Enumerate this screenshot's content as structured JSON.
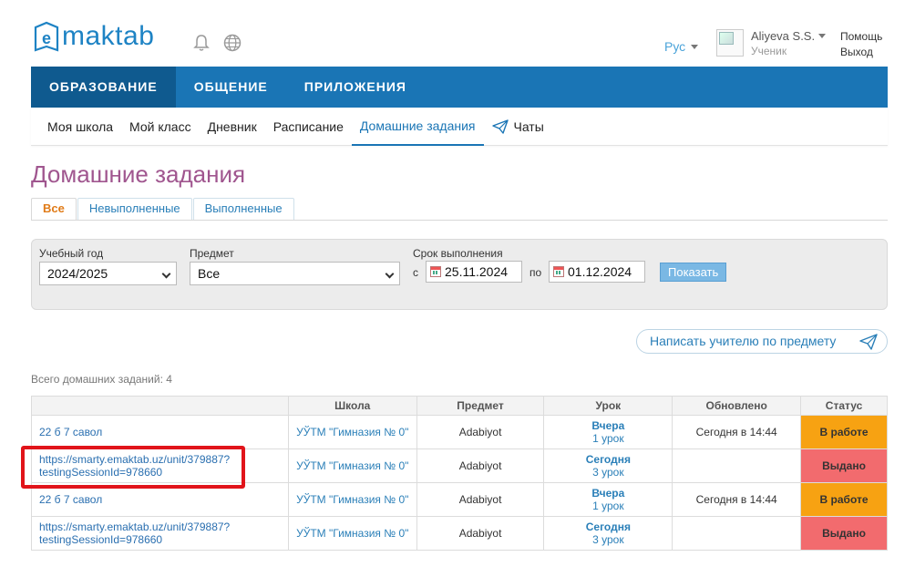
{
  "header": {
    "logo_text": "maktab",
    "logo_letter": "e",
    "language": "Рус",
    "user_name": "Aliyeva S.S.",
    "user_role": "Ученик",
    "help": "Помощь",
    "logout": "Выход"
  },
  "main_nav": [
    "ОБРАЗОВАНИЕ",
    "ОБЩЕНИЕ",
    "ПРИЛОЖЕНИЯ"
  ],
  "sub_nav": [
    "Моя школа",
    "Мой класс",
    "Дневник",
    "Расписание",
    "Домашние задания",
    "Чаты"
  ],
  "page_title": "Домашние задания",
  "tabs": [
    "Все",
    "Невыполненные",
    "Выполненные"
  ],
  "filters": {
    "year_label": "Учебный год",
    "year_value": "2024/2025",
    "subject_label": "Предмет",
    "subject_value": "Все",
    "deadline_label": "Срок выполнения",
    "from_label": "с",
    "from_value": "25.11.2024",
    "to_label": "по",
    "to_value": "01.12.2024",
    "show_button": "Показать"
  },
  "write_teacher": "Написать учителю по предмету",
  "total": "Всего домашних заданий: 4",
  "table": {
    "headers": [
      "",
      "Школа",
      "Предмет",
      "Урок",
      "Обновлено",
      "Статус"
    ],
    "rows": [
      {
        "name_line1": "22 б 7 савол",
        "name_line2": "",
        "school": "УЎТМ \"Гимназия № 0\"",
        "subject": "Adabiyot",
        "day": "Вчера",
        "lesson": "1 урок",
        "updated": "Сегодня в 14:44",
        "status": "В работе"
      },
      {
        "name_line1": "https://smarty.emaktab.uz/unit/379887?",
        "name_line2": "testingSessionId=978660",
        "school": "УЎТМ \"Гимназия № 0\"",
        "subject": "Adabiyot",
        "day": "Сегодня",
        "lesson": "3 урок",
        "updated": "",
        "status": "Выдано"
      },
      {
        "name_line1": "22 б 7 савол",
        "name_line2": "",
        "school": "УЎТМ \"Гимназия № 0\"",
        "subject": "Adabiyot",
        "day": "Вчера",
        "lesson": "1 урок",
        "updated": "Сегодня в 14:44",
        "status": "В работе"
      },
      {
        "name_line1": "https://smarty.emaktab.uz/unit/379887?",
        "name_line2": "testingSessionId=978660",
        "school": "УЎТМ \"Гимназия № 0\"",
        "subject": "Adabiyot",
        "day": "Сегодня",
        "lesson": "3 урок",
        "updated": "",
        "status": "Выдано"
      }
    ]
  },
  "colors": {
    "brand_blue": "#1a75b5",
    "title_purple": "#a0568f",
    "status_in_work": "#f7a212",
    "status_issued": "#f26b6e",
    "highlight_box": "#e1141a"
  }
}
